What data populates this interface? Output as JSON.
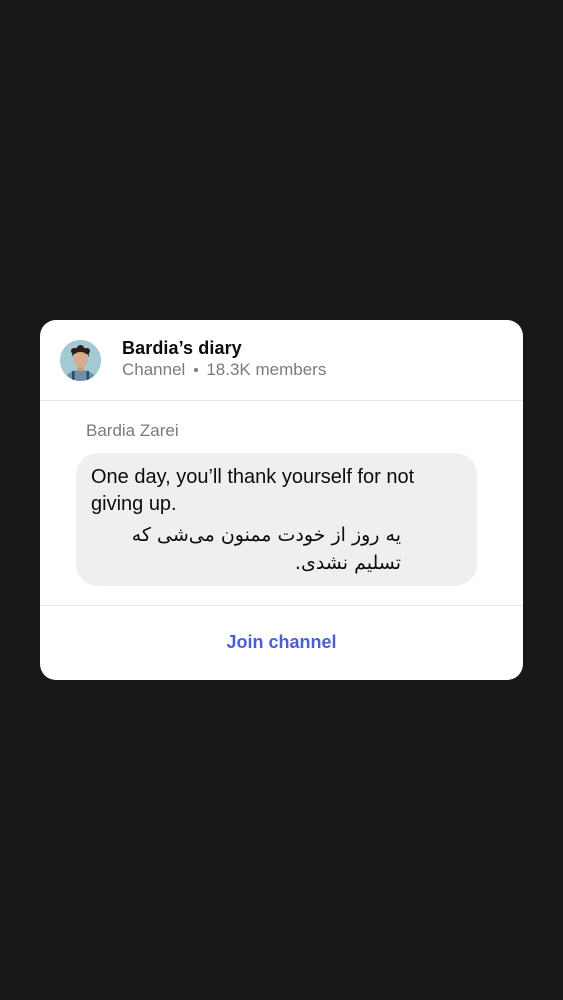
{
  "colors": {
    "background": "#171717",
    "card": "#ffffff",
    "bubble": "#efefef",
    "accent": "#4a5fd0",
    "muted_text": "#7b7b7b"
  },
  "channel": {
    "avatar_icon": "avatar-photo",
    "title": "Bardia’s diary",
    "type_label": "Channel",
    "members": "18.3K members"
  },
  "message": {
    "sender": "Bardia Zarei",
    "text_en": "One day, you’ll thank yourself for not giving up.",
    "text_fa": "یه روز از خودت ممنون می‌شی که تسلیم نشدی."
  },
  "actions": {
    "join_label": "Join channel"
  }
}
